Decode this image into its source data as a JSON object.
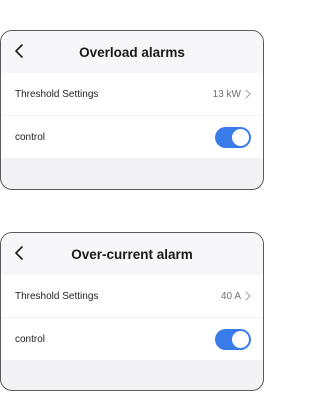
{
  "colors": {
    "accent": "#3a7bea",
    "panel_bg": "#f2f2f4",
    "border": "#5a5a5a"
  },
  "panels": [
    {
      "title": "Overload alarms",
      "back_icon": "chevron-left-icon",
      "threshold": {
        "label": "Threshold Settings",
        "value": "13 kW"
      },
      "control": {
        "label": "control",
        "enabled": true
      }
    },
    {
      "title": "Over-current alarm",
      "back_icon": "chevron-left-icon",
      "threshold": {
        "label": "Threshold Settings",
        "value": "40 A"
      },
      "control": {
        "label": "control",
        "enabled": true
      }
    }
  ]
}
